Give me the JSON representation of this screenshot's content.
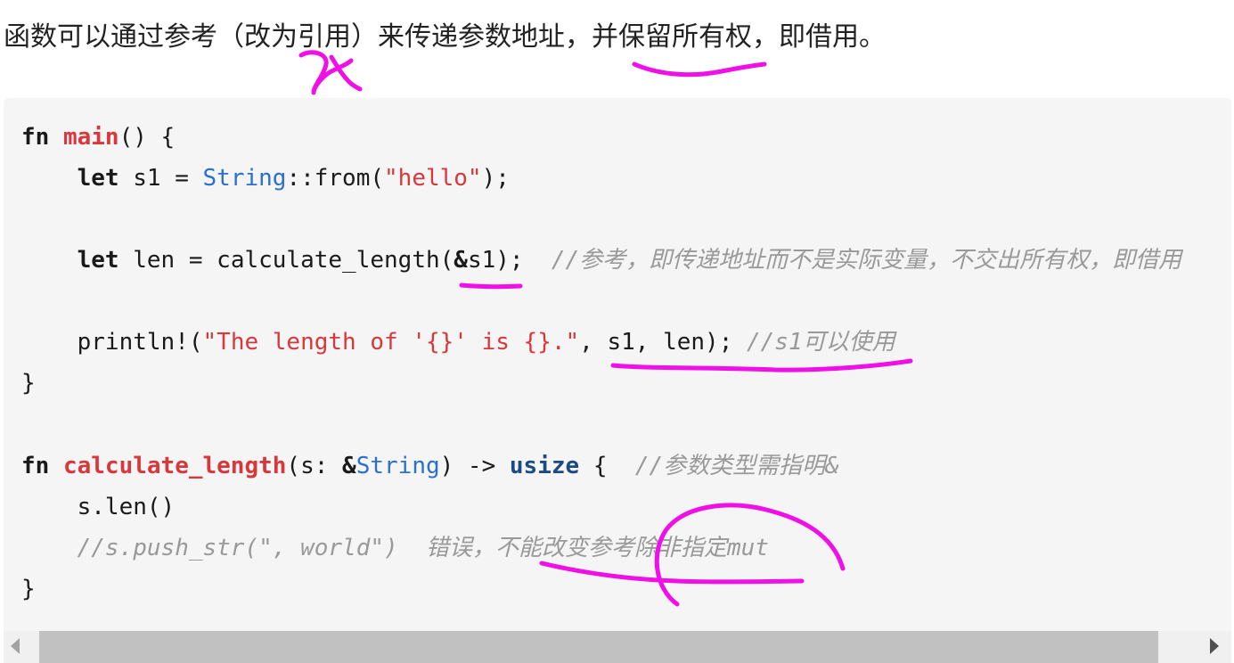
{
  "intro_text": "函数可以通过参考（改为引用）来传递参数地址，并保留所有权，即借用。",
  "code": {
    "l1": {
      "kw": "fn",
      "sp": " ",
      "name": "main",
      "rest": "() {"
    },
    "l2": {
      "ind": "    ",
      "kw": "let",
      "a": " s1 = ",
      "type": "String",
      "b": "::from(",
      "str": "\"hello\"",
      "c": ");"
    },
    "l3": {
      "ind": "    ",
      "kw": "let",
      "a": " len = calculate_length(",
      "amp": "&",
      "b": "s1);",
      "gap": "  ",
      "comment": "//参考，即传递地址而不是实际变量，不交出所有权，即借用"
    },
    "l4": {
      "ind": "    ",
      "a": "println!(",
      "str": "\"The length of '{}' is {}.\"",
      "b": ", s1, len);",
      "gap": " ",
      "comment": "//s1可以使用"
    },
    "l5": {
      "a": "}"
    },
    "l6": {
      "kw": "fn",
      "sp": " ",
      "name": "calculate_length",
      "a": "(s: ",
      "amp": "&",
      "type": "String",
      "b": ") -> ",
      "ret": "usize",
      "c": " {",
      "gap": "  ",
      "comment": "//参数类型需指明&"
    },
    "l7": {
      "ind": "    ",
      "a": "s.len()"
    },
    "l8": {
      "ind": "    ",
      "comment": "//s.push_str(\", world\")  错误，不能改变参考除非指定mut"
    },
    "l9": {
      "a": "}"
    }
  },
  "annotations": {
    "color": "#f00fe6",
    "handwritten_mark": "&"
  },
  "colors": {
    "code_background": "#f5f5f5",
    "keyword": "#1a1a1a",
    "function_name": "#d8383b",
    "type": "#2a6fd1",
    "string": "#d8383b",
    "comment": "#999999"
  },
  "scrollbar": {
    "left_arrow_icon": "triangle-left-icon",
    "right_arrow_icon": "triangle-right-icon"
  }
}
